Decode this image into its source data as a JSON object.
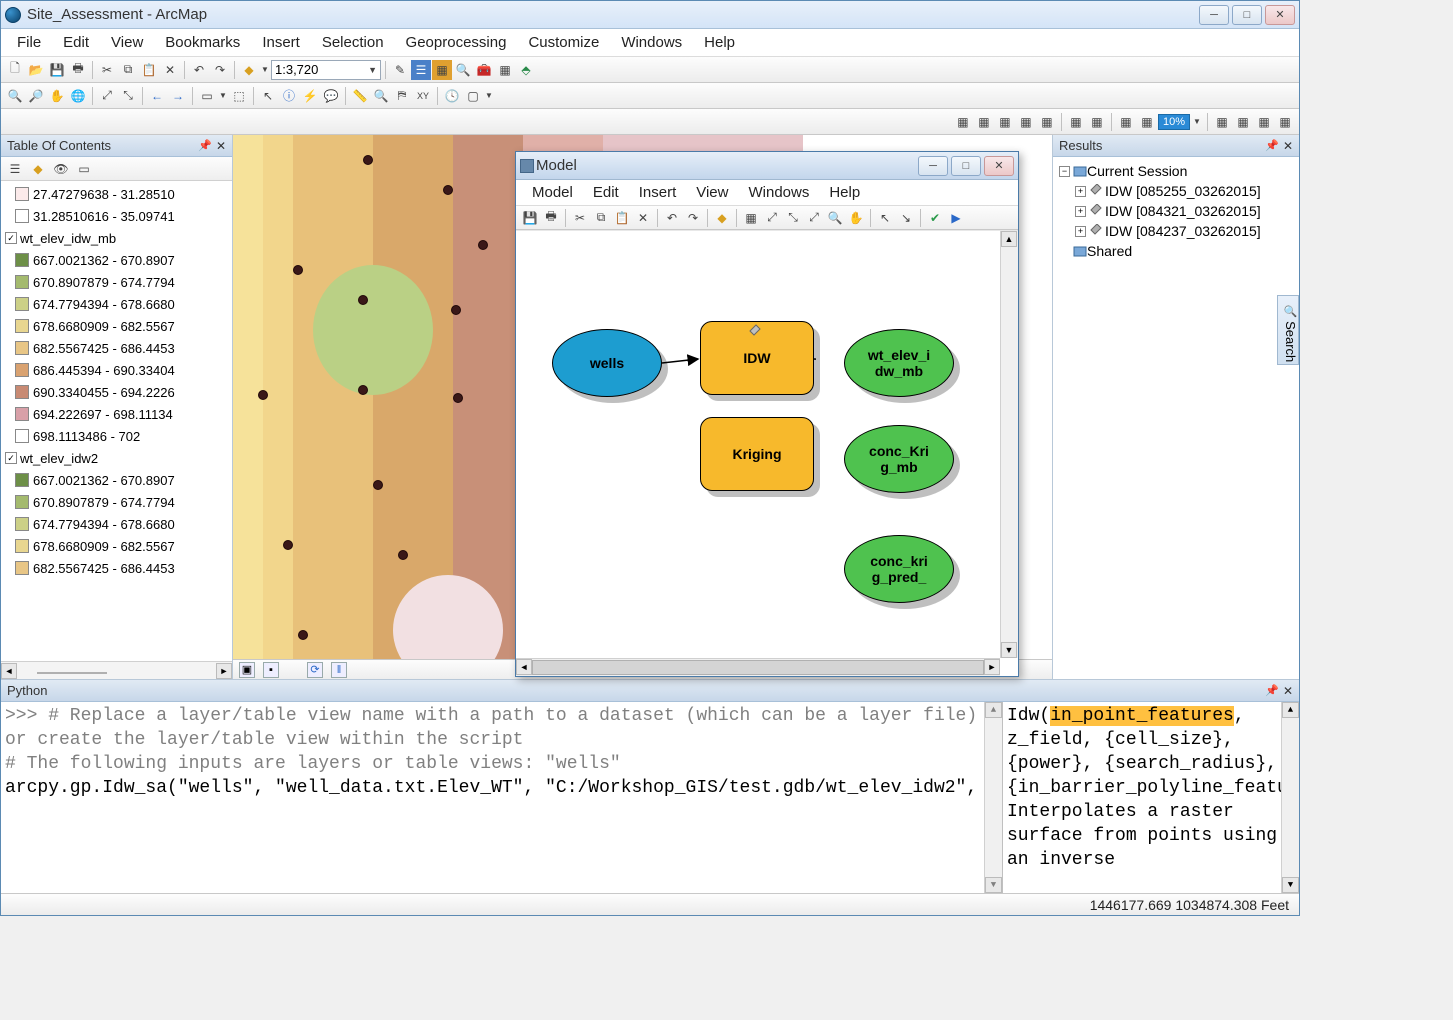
{
  "app_title": "Site_Assessment - ArcMap",
  "menu": [
    "File",
    "Edit",
    "View",
    "Bookmarks",
    "Insert",
    "Selection",
    "Geoprocessing",
    "Customize",
    "Windows",
    "Help"
  ],
  "scale": "1:3,720",
  "zoom_pct": "10%",
  "toc": {
    "title": "Table Of Contents",
    "items": [
      {
        "type": "class",
        "swatch": "#fbeaea",
        "label": "27.47279638 - 31.28510"
      },
      {
        "type": "class",
        "swatch": "#ffffff",
        "label": "31.28510616 - 35.09741"
      },
      {
        "type": "layer",
        "checked": true,
        "label": "wt_elev_idw_mb"
      },
      {
        "type": "class",
        "swatch": "#6d8f47",
        "label": "667.0021362 - 670.8907"
      },
      {
        "type": "class",
        "swatch": "#a4ba6e",
        "label": "670.8907879 - 674.7794"
      },
      {
        "type": "class",
        "swatch": "#ccd087",
        "label": "674.7794394 - 678.6680"
      },
      {
        "type": "class",
        "swatch": "#e8d690",
        "label": "678.6680909 - 682.5567"
      },
      {
        "type": "class",
        "swatch": "#e8c686",
        "label": "682.5567425 - 686.4453"
      },
      {
        "type": "class",
        "swatch": "#d9a270",
        "label": "686.445394 - 690.33404"
      },
      {
        "type": "class",
        "swatch": "#c88a73",
        "label": "690.3340455 - 694.2226"
      },
      {
        "type": "class",
        "swatch": "#d8a0a8",
        "label": "694.222697 - 698.11134"
      },
      {
        "type": "class",
        "swatch": "#ffffff",
        "label": "698.1113486 - 702"
      },
      {
        "type": "layer",
        "checked": true,
        "label": "wt_elev_idw2"
      },
      {
        "type": "class",
        "swatch": "#6d8f47",
        "label": "667.0021362 - 670.8907"
      },
      {
        "type": "class",
        "swatch": "#a4ba6e",
        "label": "670.8907879 - 674.7794"
      },
      {
        "type": "class",
        "swatch": "#ccd087",
        "label": "674.7794394 - 678.6680"
      },
      {
        "type": "class",
        "swatch": "#e8d690",
        "label": "678.6680909 - 682.5567"
      },
      {
        "type": "class",
        "swatch": "#e8c686",
        "label": "682.5567425 - 686.4453"
      }
    ]
  },
  "results": {
    "title": "Results",
    "nodes": {
      "root": "Current Session",
      "items": [
        "IDW [085255_03262015]",
        "IDW [084321_03262015]",
        "IDW [084237_03262015]"
      ],
      "shared": "Shared"
    }
  },
  "search_tab": "Search",
  "model": {
    "title": "Model",
    "menu": [
      "Model",
      "Edit",
      "Insert",
      "View",
      "Windows",
      "Help"
    ],
    "nodes": {
      "wells": "wells",
      "idw": "IDW",
      "krig": "Kriging",
      "out_idw": "wt_elev_i\ndw_mb",
      "out_krig": "conc_Kri\ng_mb",
      "out_pred": "conc_kri\ng_pred_"
    }
  },
  "python": {
    "title": "Python",
    "left": ">>> # Replace a layer/table view name with a path to a dataset (which can be a layer file) or create the layer/table view within the script\n# The following inputs are layers or table views: \"wells\"\narcpy.gp.Idw_sa(\"wells\", \"well_data.txt.Elev_WT\", \"C:/Workshop_GIS/test.gdb/wt_elev_idw2\",",
    "right_prefix": "Idw(",
    "right_hl": "in_point_features",
    "right_rest": ", z_field, {cell_size}, {power}, {search_radius}, {in_barrier_polyline_features})\n  Interpolates a raster surface from points using an inverse"
  },
  "status": "1446177.669 1034874.308 Feet"
}
